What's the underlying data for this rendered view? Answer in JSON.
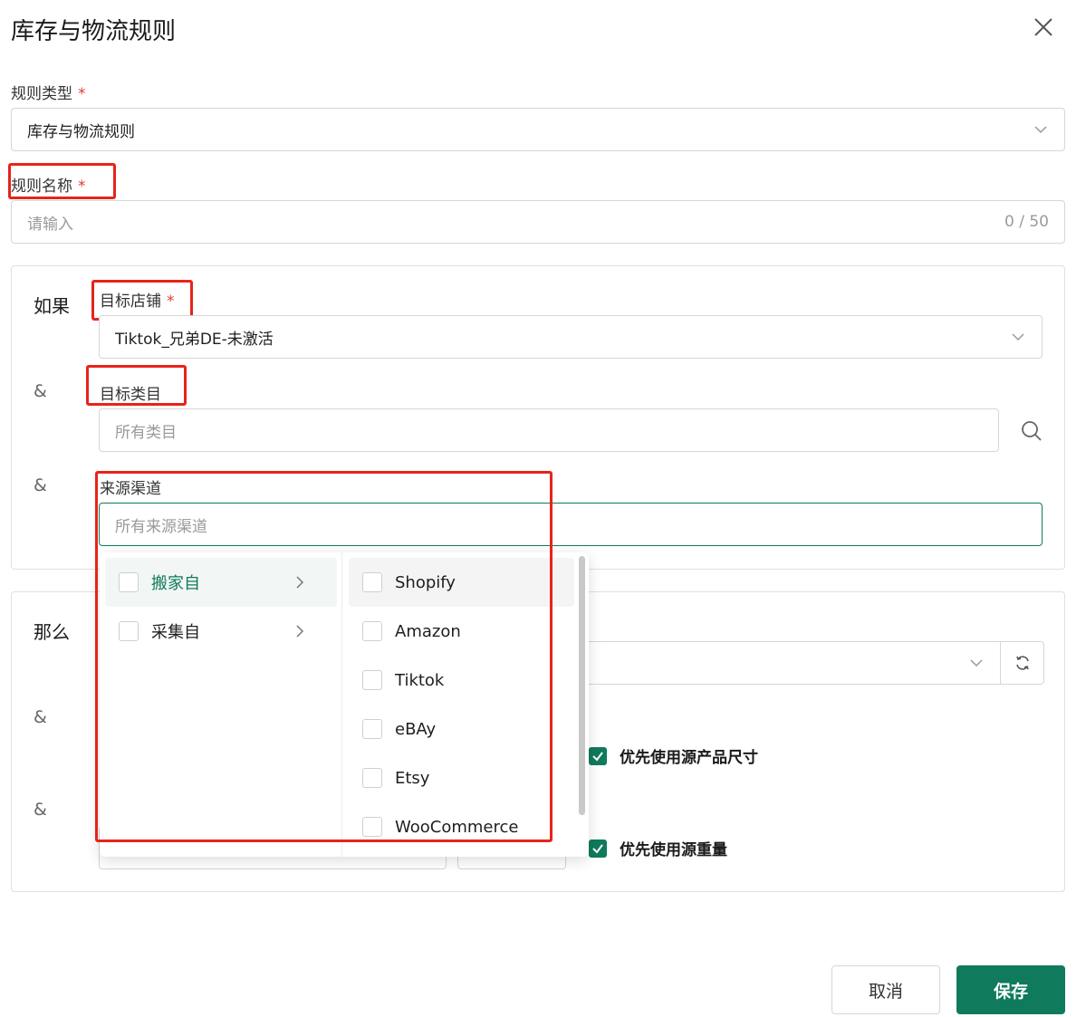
{
  "dialog": {
    "title": "库存与物流规则"
  },
  "rule_type": {
    "label": "规则类型",
    "required": "*",
    "value": "库存与物流规则"
  },
  "rule_name": {
    "label": "规则名称",
    "required": "*",
    "placeholder": "请输入",
    "counter": "0 / 50"
  },
  "if_section": {
    "keyword": "如果",
    "amp": "&",
    "target_store": {
      "label": "目标店铺",
      "required": "*",
      "value": "Tiktok_兄弟DE-未激活"
    },
    "target_category": {
      "label": "目标类目",
      "placeholder": "所有类目"
    },
    "source_channel": {
      "label": "来源渠道",
      "placeholder": "所有来源渠道"
    }
  },
  "then_section": {
    "keyword": "那么",
    "amp": "&",
    "pref_size_label": "优先使用源产品尺寸",
    "pref_weight_label": "优先使用源重量"
  },
  "dropdown": {
    "groups": [
      {
        "label": "搬家自"
      },
      {
        "label": "采集自"
      }
    ],
    "options": [
      {
        "label": "Shopify"
      },
      {
        "label": "Amazon"
      },
      {
        "label": "Tiktok"
      },
      {
        "label": "eBAy"
      },
      {
        "label": "Etsy"
      },
      {
        "label": "WooCommerce"
      }
    ]
  },
  "footer": {
    "cancel_label": "取消",
    "save_label": "保存"
  },
  "colors": {
    "accent": "#107a5c",
    "required": "#e53935",
    "highlight": "#e8231b"
  }
}
